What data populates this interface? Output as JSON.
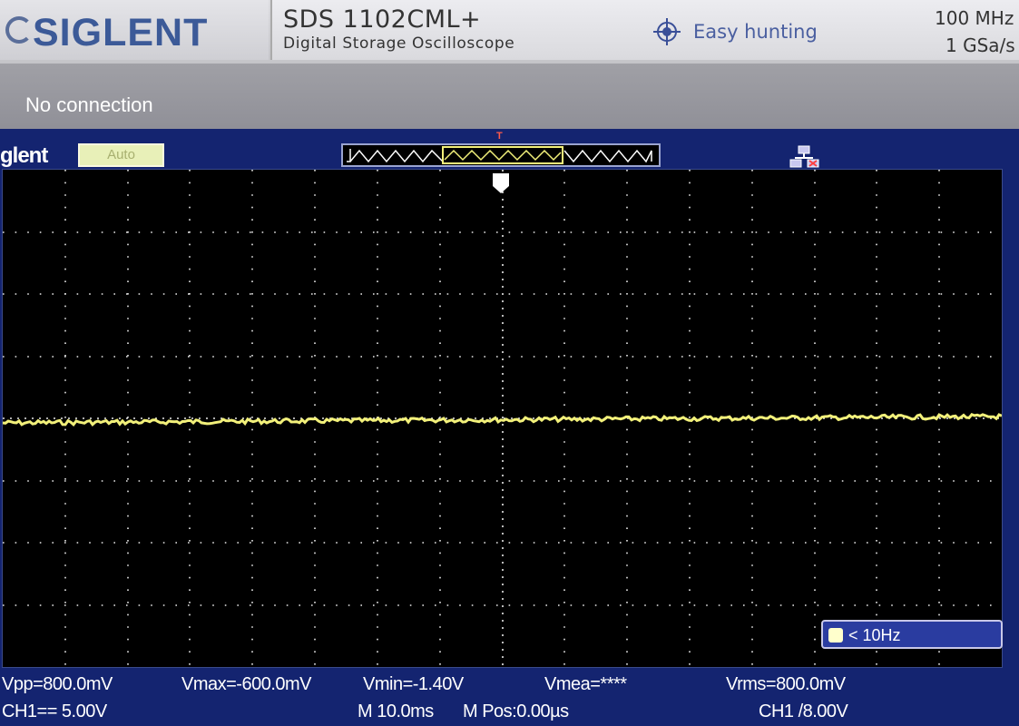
{
  "header": {
    "brand": "SIGLENT",
    "model": "SDS 1102CML+",
    "description": "Digital Storage Oscilloscope",
    "feature": "Easy hunting",
    "bandwidth": "100 MHz",
    "sample_rate": "1 GSa/s"
  },
  "overlay": {
    "message": "No connection"
  },
  "screen": {
    "brand": "glent",
    "trigger_mode": "Auto",
    "trigger_marker": "T",
    "frequency": "< 10Hz"
  },
  "measurements": {
    "vpp": "Vpp=800.0mV",
    "vmax": "Vmax=-600.0mV",
    "vmin": "Vmin=-1.40V",
    "vmean": "Vmea=****",
    "vrms": "Vrms=800.0mV"
  },
  "status": {
    "channel": "CH1== 5.00V",
    "timebase": "M 10.0ms",
    "position": "M Pos:0.00µs",
    "trigger": "CH1 /8.00V"
  },
  "colors": {
    "trace": "#f2f07a",
    "screen_bg": "#142470",
    "brand": "#3c5a98"
  },
  "icons": [
    "crosshair-icon",
    "network-icon",
    "trigger-point-icon"
  ]
}
